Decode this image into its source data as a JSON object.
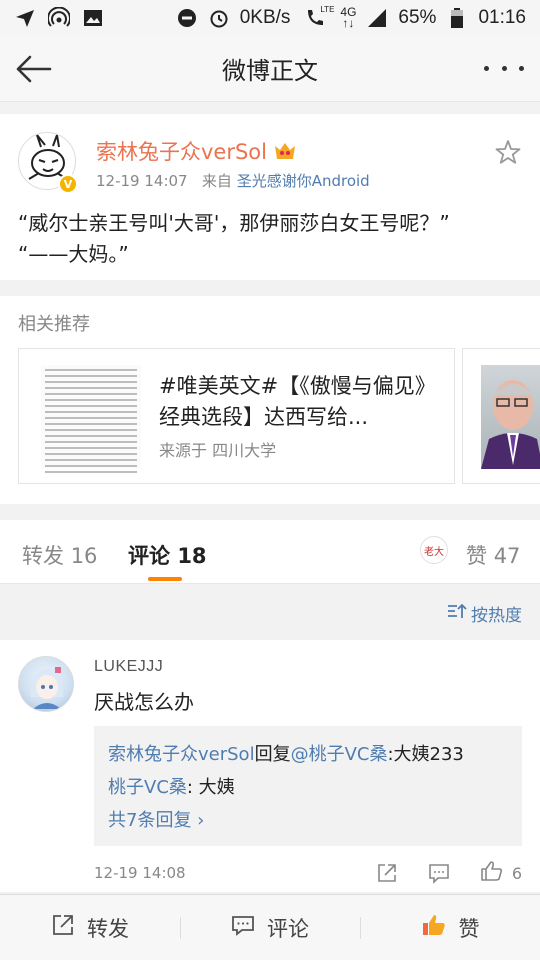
{
  "status_bar": {
    "net_speed": "0KB/s",
    "lte_label": "LTE",
    "network_label": "4G",
    "battery": "65%",
    "time": "01:16",
    "icons": [
      "send-icon",
      "hotspot-icon",
      "gallery-icon",
      "dnd-icon",
      "alarm-icon",
      "call-lte-icon",
      "signal-icon",
      "battery-icon"
    ]
  },
  "title_bar": {
    "title": "微博正文",
    "back_icon": "back-arrow-icon",
    "more_icon": "more-icon"
  },
  "post": {
    "author": "索林兔子众verSol",
    "verified_badge": "V",
    "time": "12-19 14:07",
    "source_prefix": "来自",
    "source": "圣光感谢你Android",
    "text_line1": "“威尔士亲王号叫'大哥'，那伊丽莎白女王号呢？”",
    "text_line2": "“——大妈。”"
  },
  "related": {
    "header": "相关推荐",
    "card_title": "#唯美英文#【《傲慢与偏见》经典选段】达西写给...",
    "card_source": "来源于 四川大学"
  },
  "tabs": {
    "repost_label": "转发",
    "repost_count": "16",
    "comment_label": "评论",
    "comment_count": "18",
    "like_label": "赞",
    "like_count": "47",
    "like_avatar_text": "老大"
  },
  "sort": {
    "label": "按热度"
  },
  "comment": {
    "username": "LUKEJJJ",
    "text": "厌战怎么办",
    "reply1_user": "索林兔子众verSol",
    "reply1_mid": "回复",
    "reply1_target": "@桃子VC桑",
    "reply1_text": ":大姨233",
    "reply2_user": "桃子VC桑",
    "reply2_text": ": 大姨",
    "more_replies": "共7条回复 ›",
    "time": "12-19 14:08",
    "like_count": "6"
  },
  "bottom_bar": {
    "repost": "转发",
    "comment": "评论",
    "like": "赞"
  },
  "colors": {
    "accent_orange": "#ff8200",
    "author_orange": "#eb7350",
    "link_blue": "#507daf",
    "like_orange": "#f06a3a"
  }
}
